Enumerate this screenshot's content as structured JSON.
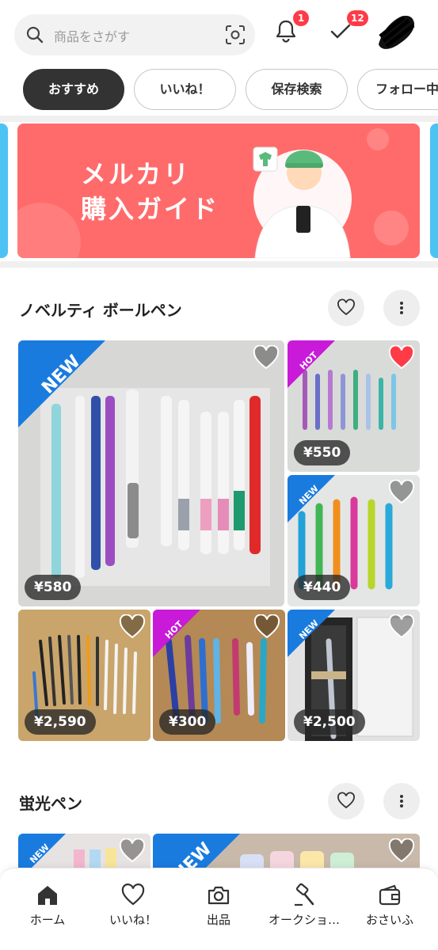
{
  "search": {
    "placeholder": "商品をさがす"
  },
  "header": {
    "notifications_badge": "1",
    "todo_badge": "12"
  },
  "tabs": [
    {
      "label": "おすすめ",
      "active": true
    },
    {
      "label": "いいね！",
      "active": false
    },
    {
      "label": "保存検索",
      "active": false
    },
    {
      "label": "フォロー中",
      "active": false
    }
  ],
  "banner": {
    "line1": "メルカリ",
    "line2": "購入ガイド",
    "color": "#ff6b6b"
  },
  "sections": [
    {
      "title": "ノベルティ ボールペン",
      "items": [
        {
          "price": "¥580",
          "tag": "NEW",
          "liked": false
        },
        {
          "price": "¥550",
          "tag": "HOT",
          "liked": true
        },
        {
          "price": "¥440",
          "tag": "NEW",
          "liked": false
        },
        {
          "price": "¥2,590",
          "tag": "",
          "liked": false
        },
        {
          "price": "¥300",
          "tag": "HOT",
          "liked": false
        },
        {
          "price": "¥2,500",
          "tag": "NEW",
          "liked": false
        }
      ]
    },
    {
      "title": "蛍光ペン",
      "items": [
        {
          "tag": "NEW"
        },
        {
          "tag": "NEW"
        }
      ]
    }
  ],
  "bottom_nav": [
    {
      "label": "ホーム",
      "icon": "home-icon",
      "active": true
    },
    {
      "label": "いいね！",
      "icon": "heart-icon",
      "active": false
    },
    {
      "label": "出品",
      "icon": "camera-icon",
      "active": false
    },
    {
      "label": "オークショ…",
      "icon": "gavel-icon",
      "active": false
    },
    {
      "label": "おさいふ",
      "icon": "wallet-icon",
      "active": false
    }
  ],
  "colors": {
    "accent": "#ff3b47",
    "new_ribbon": "#1a7bdf",
    "hot_ribbon": "#c81ad8"
  }
}
